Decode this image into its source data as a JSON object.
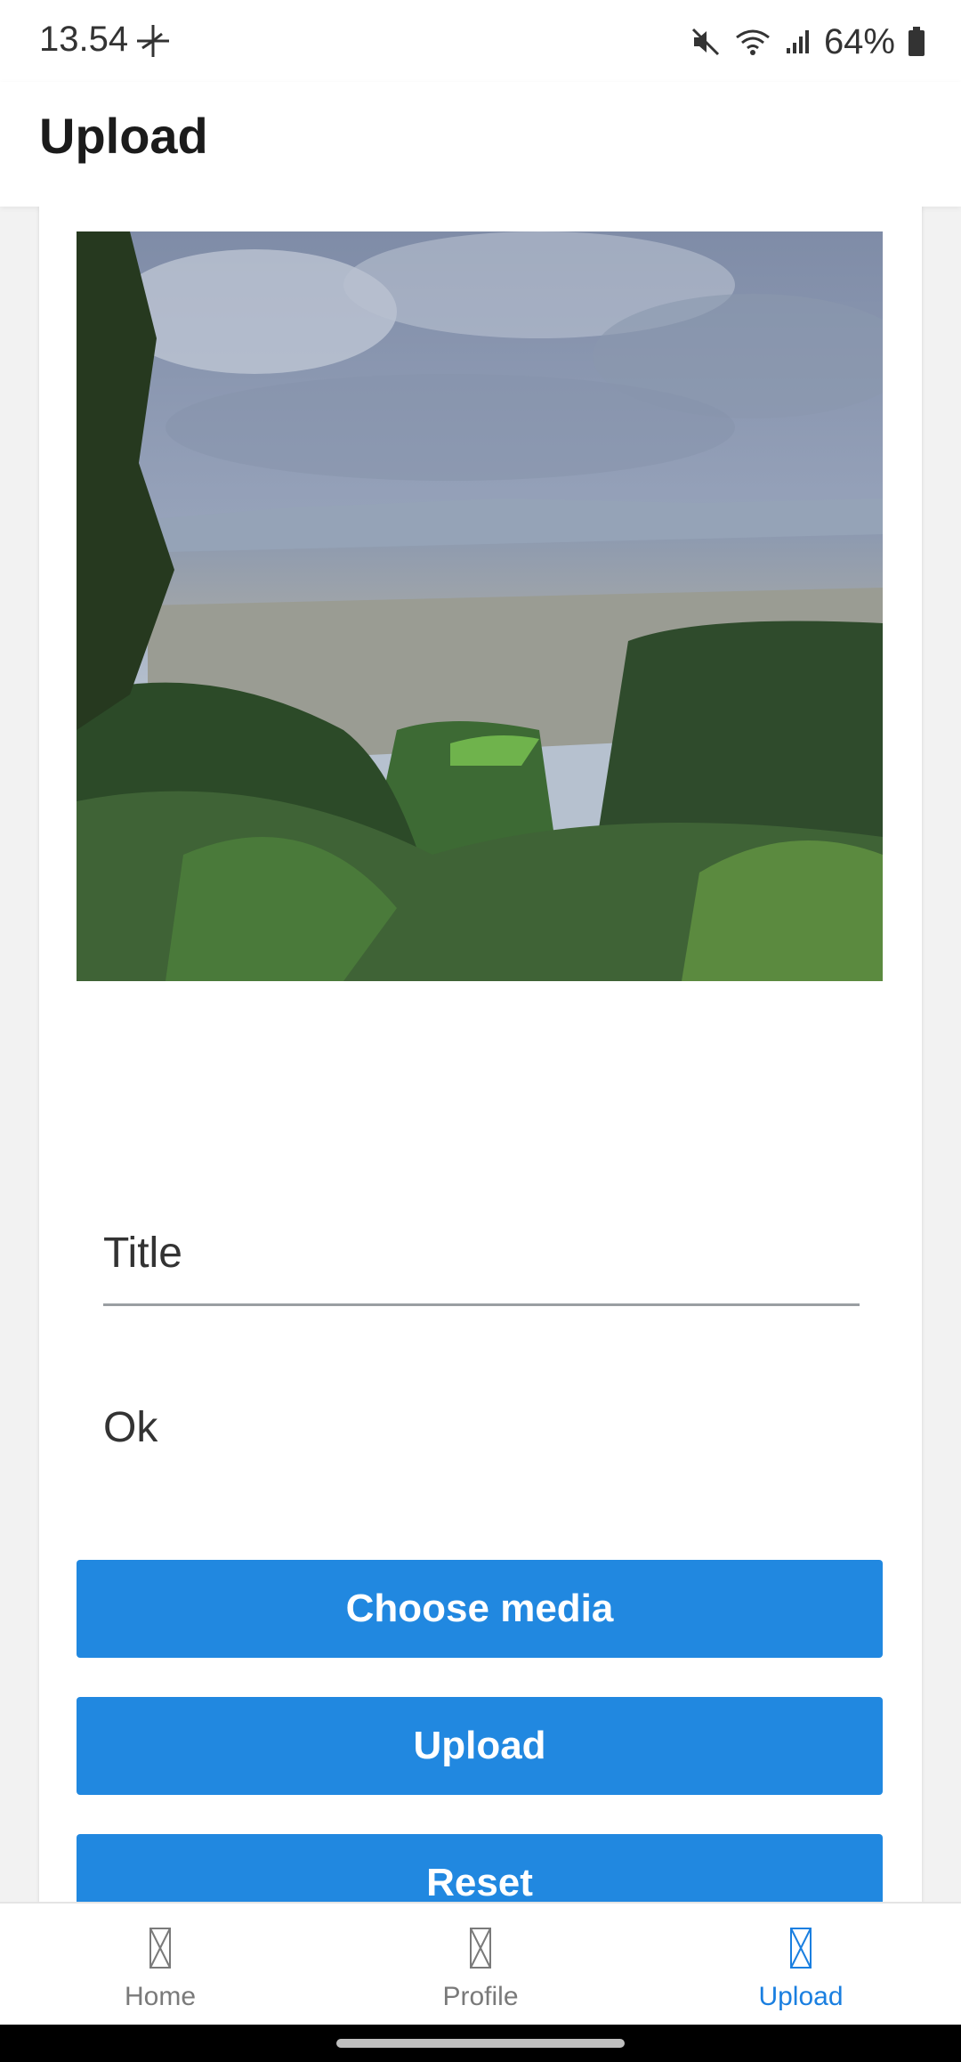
{
  "status_bar": {
    "time": "13.54",
    "battery": "64%"
  },
  "header": {
    "title": "Upload"
  },
  "form": {
    "title_placeholder": "Title",
    "description_value": "Ok"
  },
  "buttons": {
    "choose_media": "Choose media",
    "upload": "Upload",
    "reset": "Reset"
  },
  "nav": {
    "items": [
      {
        "label": "Home",
        "active": false
      },
      {
        "label": "Profile",
        "active": false
      },
      {
        "label": "Upload",
        "active": true
      }
    ]
  },
  "colors": {
    "accent": "#2188e0",
    "nav_active": "#1a7fe0"
  }
}
